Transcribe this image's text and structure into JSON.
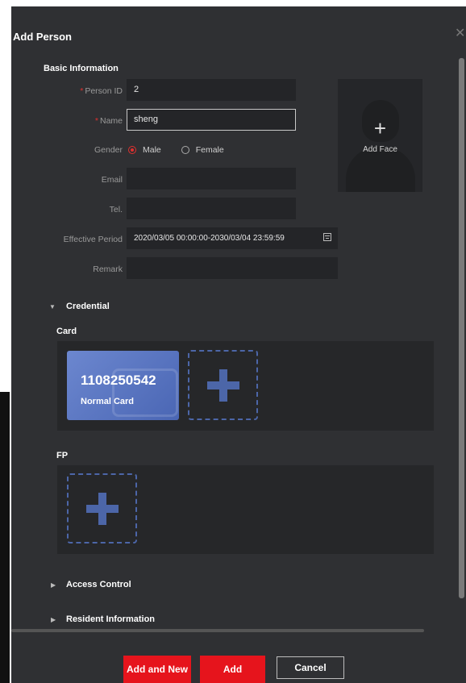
{
  "dialog": {
    "title": "Add Person",
    "close_icon": "close-icon",
    "basic_section": "Basic Information",
    "fields": {
      "person_id_label": "Person ID",
      "person_id_value": "2",
      "name_label": "Name",
      "name_value": "sheng",
      "gender_label": "Gender",
      "gender_male": "Male",
      "gender_female": "Female",
      "gender_selected": "Male",
      "email_label": "Email",
      "email_value": "",
      "tel_label": "Tel.",
      "tel_value": "",
      "effective_label": "Effective Period",
      "effective_value": "2020/03/05 00:00:00-2030/03/04 23:59:59",
      "remark_label": "Remark",
      "remark_value": ""
    },
    "face": {
      "label": "Add Face",
      "plus": "+"
    },
    "credential": {
      "title": "Credential",
      "card_label": "Card",
      "card": {
        "number": "1108250542",
        "type": "Normal Card"
      },
      "fp_label": "FP"
    },
    "access_control": "Access Control",
    "resident_info": "Resident Information",
    "buttons": {
      "add_and_new": "Add and New",
      "add": "Add",
      "cancel": "Cancel"
    },
    "colors": {
      "accent": "#e6141c",
      "card_blue": "#5a76c4",
      "dashed": "#4c66a8"
    }
  }
}
